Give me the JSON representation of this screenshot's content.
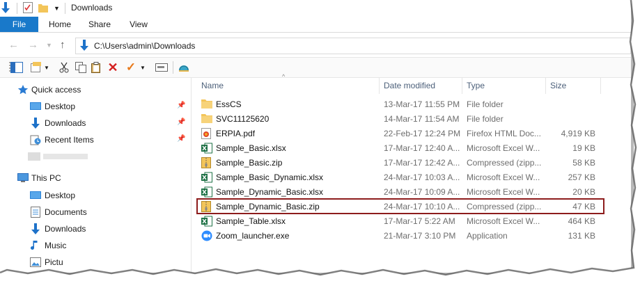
{
  "window": {
    "title": "Downloads"
  },
  "ribbon": {
    "tabs": [
      {
        "label": "File"
      },
      {
        "label": "Home"
      },
      {
        "label": "Share"
      },
      {
        "label": "View"
      }
    ]
  },
  "address": {
    "path": "C:\\Users\\admin\\Downloads"
  },
  "nav": {
    "quick_access": "Quick access",
    "quick_items": [
      {
        "label": "Desktop",
        "icon": "desktop-icon"
      },
      {
        "label": "Downloads",
        "icon": "download-arrow-icon"
      },
      {
        "label": "Recent Items",
        "icon": "recent-items-icon"
      }
    ],
    "this_pc": "This PC",
    "pc_items": [
      {
        "label": "Desktop",
        "icon": "desktop-icon"
      },
      {
        "label": "Documents",
        "icon": "documents-icon"
      },
      {
        "label": "Downloads",
        "icon": "download-arrow-icon"
      },
      {
        "label": "Music",
        "icon": "music-icon"
      },
      {
        "label": "Pictu",
        "icon": "pictures-icon"
      }
    ]
  },
  "columns": {
    "name": "Name",
    "date": "Date modified",
    "type": "Type",
    "size": "Size"
  },
  "files": [
    {
      "name": "EssCS",
      "date": "13-Mar-17 11:55 PM",
      "type": "File folder",
      "size": "",
      "icon": "folder-icon"
    },
    {
      "name": "SVC11125620",
      "date": "14-Mar-17 11:54 AM",
      "type": "File folder",
      "size": "",
      "icon": "folder-icon"
    },
    {
      "name": "ERPIA.pdf",
      "date": "22-Feb-17 12:24 PM",
      "type": "Firefox HTML Doc...",
      "size": "4,919 KB",
      "icon": "pdf-icon"
    },
    {
      "name": "Sample_Basic.xlsx",
      "date": "17-Mar-17 12:40 A...",
      "type": "Microsoft Excel W...",
      "size": "19 KB",
      "icon": "excel-icon"
    },
    {
      "name": "Sample_Basic.zip",
      "date": "17-Mar-17 12:42 A...",
      "type": "Compressed (zipp...",
      "size": "58 KB",
      "icon": "zip-icon"
    },
    {
      "name": "Sample_Basic_Dynamic.xlsx",
      "date": "24-Mar-17 10:03 A...",
      "type": "Microsoft Excel W...",
      "size": "257 KB",
      "icon": "excel-icon"
    },
    {
      "name": "Sample_Dynamic_Basic.xlsx",
      "date": "24-Mar-17 10:09 A...",
      "type": "Microsoft Excel W...",
      "size": "20 KB",
      "icon": "excel-icon"
    },
    {
      "name": "Sample_Dynamic_Basic.zip",
      "date": "24-Mar-17 10:10 A...",
      "type": "Compressed (zipp...",
      "size": "47 KB",
      "icon": "zip-icon"
    },
    {
      "name": "Sample_Table.xlsx",
      "date": "17-Mar-17 5:22 AM",
      "type": "Microsoft Excel W...",
      "size": "464 KB",
      "icon": "excel-icon"
    },
    {
      "name": "Zoom_launcher.exe",
      "date": "21-Mar-17 3:10 PM",
      "type": "Application",
      "size": "131 KB",
      "icon": "zoom-app-icon"
    }
  ],
  "colors": {
    "accent": "#1979ca",
    "highlight_border": "#8d1c1c",
    "folder": "#f3c55a",
    "excel": "#1e7145"
  }
}
